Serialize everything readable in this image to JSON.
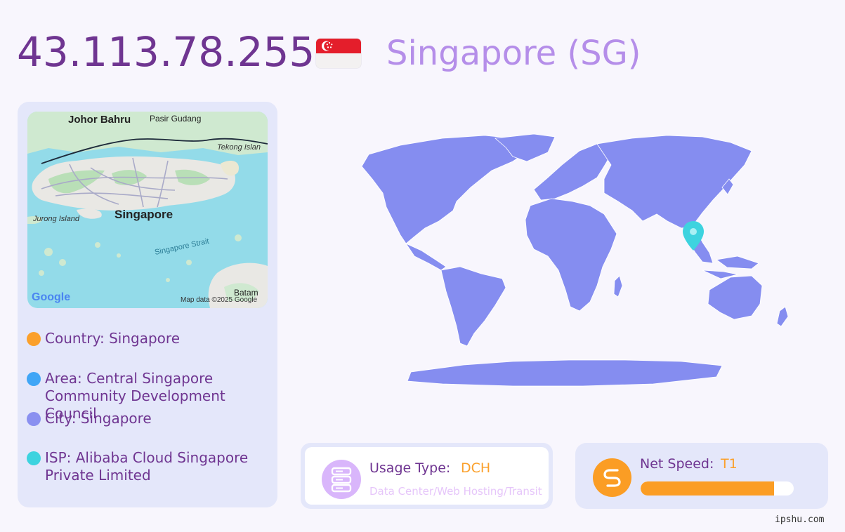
{
  "header": {
    "ip": "43.113.78.255",
    "country_title": "Singapore (SG)"
  },
  "map": {
    "labels": {
      "johor": "Johor Bahru",
      "pasir": "Pasir Gudang",
      "tekong": "Tekong Islan",
      "jurong": "Jurong Island",
      "singapore": "Singapore",
      "strait": "Singapore Strait",
      "batam": "Batam",
      "google": "Google",
      "attribution": "Map data ©2025 Google"
    }
  },
  "info": [
    {
      "label": "Country: Singapore",
      "color": "#fba02b"
    },
    {
      "label": "Area: Central Singapore Community Development Council",
      "color": "#40a6f6"
    },
    {
      "label": "City: Singapore",
      "color": "#8a90f0"
    },
    {
      "label": "ISP: Alibaba Cloud Singapore Private Limited",
      "color": "#3dd3df"
    }
  ],
  "usage": {
    "label": "Usage Type:",
    "value": "DCH",
    "description": "Data Center/Web Hosting/Transit",
    "icon": "server-icon"
  },
  "speed": {
    "label": "Net Speed:",
    "value": "T1",
    "level": 0.87,
    "icon": "speed-icon"
  },
  "colors": {
    "accent_purple": "#6f3591",
    "accent_orange": "#fba02b",
    "map_land": "#858df0",
    "pin": "#3dd3df"
  },
  "watermark": "ipshu.com"
}
